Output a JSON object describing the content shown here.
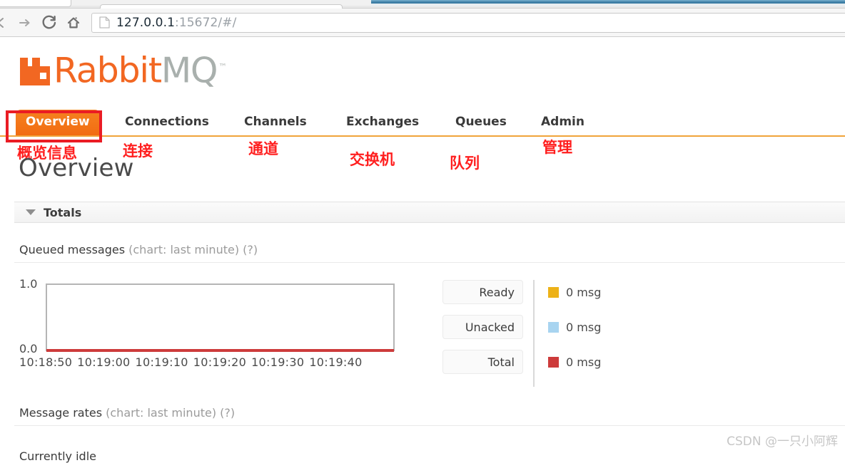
{
  "browser": {
    "back_icon": "back-arrow-icon",
    "forward_icon": "forward-arrow-icon",
    "reload_icon": "reload-icon",
    "home_icon": "home-icon",
    "page_icon": "page-document-icon",
    "url_host": "127.0.0.1",
    "url_rest": ":15672/#/"
  },
  "logo": {
    "mark": "rabbitmq-rabbit-icon",
    "word_rabbit": "Rabbit",
    "word_mq": "MQ",
    "trademark": "™"
  },
  "nav": {
    "tabs": [
      {
        "label": "Overview",
        "cn": "概览信息",
        "active": true
      },
      {
        "label": "Connections",
        "cn": "连接",
        "active": false
      },
      {
        "label": "Channels",
        "cn": "通道",
        "active": false
      },
      {
        "label": "Exchanges",
        "cn": "交换机",
        "active": false
      },
      {
        "label": "Queues",
        "cn": "队列",
        "active": false
      },
      {
        "label": "Admin",
        "cn": "管理",
        "active": false
      }
    ],
    "underline_color": "#f0a43a",
    "active_color": "#f58220",
    "annotation_color": "#ea1c24"
  },
  "page": {
    "title": "Overview",
    "section": {
      "title": "Totals",
      "caret": "caret-down-icon"
    },
    "queued_heading": {
      "strong": "Queued messages",
      "muted": "(chart: last minute) (?)"
    },
    "rates_heading": {
      "strong": "Message rates",
      "muted": "(chart: last minute) (?)"
    },
    "idle_text": "Currently idle"
  },
  "chart_data": {
    "type": "line",
    "title": "Queued messages (chart: last minute)",
    "xlabel": "",
    "ylabel": "",
    "ylim": [
      0.0,
      1.0
    ],
    "ytick_labels": [
      "1.0",
      "0.0"
    ],
    "xtick_labels": [
      "10:18:50",
      "10:19:00",
      "10:19:10",
      "10:19:20",
      "10:19:30",
      "10:19:40"
    ],
    "grid": false,
    "legend_position": "right",
    "series": [
      {
        "name": "Ready",
        "color": "#edb218",
        "value_label": "0 msg",
        "values": [
          0,
          0,
          0,
          0,
          0,
          0
        ]
      },
      {
        "name": "Unacked",
        "color": "#a8d4f0",
        "value_label": "0 msg",
        "values": [
          0,
          0,
          0,
          0,
          0,
          0
        ]
      },
      {
        "name": "Total",
        "color": "#cd3b3b",
        "value_label": "0 msg",
        "values": [
          0,
          0,
          0,
          0,
          0,
          0
        ]
      }
    ]
  },
  "watermark": "CSDN @一只小阿辉"
}
